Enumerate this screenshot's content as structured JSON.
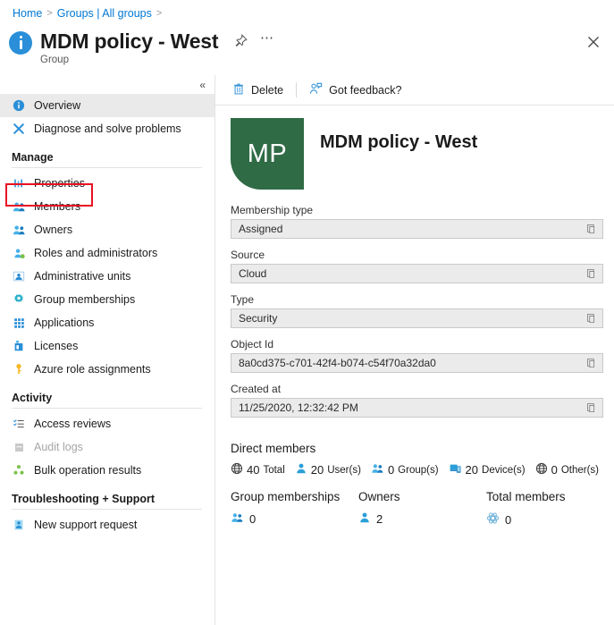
{
  "breadcrumb": {
    "items": [
      "Home",
      "Groups | All groups"
    ],
    "separator": ">"
  },
  "header": {
    "title": "MDM policy - West",
    "subtitle": "Group",
    "pin_icon": "pin-icon",
    "more_icon": "ellipsis-icon",
    "close_icon": "close-icon"
  },
  "sidebar": {
    "collapse_icon": "double-chevron-left-icon",
    "items": [
      {
        "label": "Overview",
        "icon": "info-circle-icon",
        "selected": true,
        "disabled": false
      },
      {
        "label": "Diagnose and solve problems",
        "icon": "wrench-cross-icon",
        "selected": false,
        "disabled": false
      }
    ],
    "sections": [
      {
        "title": "Manage",
        "items": [
          {
            "label": "Properties",
            "icon": "properties-bars-icon",
            "highlighted": true,
            "disabled": false
          },
          {
            "label": "Members",
            "icon": "members-icon",
            "highlighted": false,
            "disabled": false
          },
          {
            "label": "Owners",
            "icon": "owners-icon",
            "highlighted": false,
            "disabled": false
          },
          {
            "label": "Roles and administrators",
            "icon": "roles-admin-icon",
            "highlighted": false,
            "disabled": false
          },
          {
            "label": "Administrative units",
            "icon": "administrative-units-icon",
            "highlighted": false,
            "disabled": false
          },
          {
            "label": "Group memberships",
            "icon": "group-memberships-gear-icon",
            "highlighted": false,
            "disabled": false
          },
          {
            "label": "Applications",
            "icon": "applications-grid-icon",
            "highlighted": false,
            "disabled": false
          },
          {
            "label": "Licenses",
            "icon": "licenses-icon",
            "highlighted": false,
            "disabled": false
          },
          {
            "label": "Azure role assignments",
            "icon": "key-icon",
            "highlighted": false,
            "disabled": false
          }
        ]
      },
      {
        "title": "Activity",
        "items": [
          {
            "label": "Access reviews",
            "icon": "access-reviews-list-icon",
            "highlighted": false,
            "disabled": false
          },
          {
            "label": "Audit logs",
            "icon": "audit-logs-icon",
            "highlighted": false,
            "disabled": true
          },
          {
            "label": "Bulk operation results",
            "icon": "bulk-operation-icon",
            "highlighted": false,
            "disabled": false
          }
        ]
      },
      {
        "title": "Troubleshooting + Support",
        "items": [
          {
            "label": "New support request",
            "icon": "support-person-icon",
            "highlighted": false,
            "disabled": false
          }
        ]
      }
    ]
  },
  "toolbar": {
    "delete_label": "Delete",
    "delete_icon": "trash-icon",
    "feedback_label": "Got feedback?",
    "feedback_icon": "feedback-person-icon"
  },
  "hero": {
    "initials": "MP",
    "name": "MDM policy - West",
    "avatar_color": "#2f6b45"
  },
  "fields": [
    {
      "label": "Membership type",
      "value": "Assigned",
      "copy_icon": "copy-icon"
    },
    {
      "label": "Source",
      "value": "Cloud",
      "copy_icon": "copy-icon"
    },
    {
      "label": "Type",
      "value": "Security",
      "copy_icon": "copy-icon"
    },
    {
      "label": "Object Id",
      "value": "8a0cd375-c701-42f4-b074-c54f70a32da0",
      "copy_icon": "copy-icon"
    },
    {
      "label": "Created at",
      "value": "11/25/2020, 12:32:42 PM",
      "copy_icon": "copy-icon"
    }
  ],
  "direct_members": {
    "title": "Direct members",
    "stats": [
      {
        "count": "40",
        "unit": "Total",
        "icon": "globe-icon"
      },
      {
        "count": "20",
        "unit": "User(s)",
        "icon": "user-icon"
      },
      {
        "count": "0",
        "unit": "Group(s)",
        "icon": "group-icon"
      },
      {
        "count": "20",
        "unit": "Device(s)",
        "icon": "device-icon"
      },
      {
        "count": "0",
        "unit": "Other(s)",
        "icon": "globe-icon"
      }
    ]
  },
  "cards": [
    {
      "title": "Group memberships",
      "value": "0",
      "icon": "group-icon"
    },
    {
      "title": "Owners",
      "value": "2",
      "icon": "user-icon"
    },
    {
      "title": "Total members",
      "value": "0",
      "icon": "atom-icon"
    }
  ],
  "colors": {
    "accent": "#0078d4",
    "highlight_box": "#e81123",
    "selected_row": "#eaeaea"
  }
}
